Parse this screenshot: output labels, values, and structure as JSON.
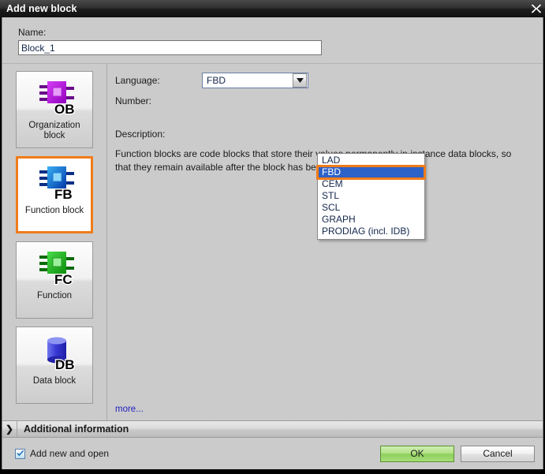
{
  "window": {
    "title": "Add new block",
    "close_icon": "close-icon"
  },
  "name_field": {
    "label": "Name:",
    "value": "Block_1",
    "placeholder": ""
  },
  "sidebar": {
    "items": [
      {
        "label": "Organization\nblock",
        "label_line1": "Organization",
        "label_line2": "block",
        "abbrev": "OB",
        "icon": "organization-block-icon",
        "color": "#b51fd4",
        "selected": false
      },
      {
        "label": "Function block",
        "label_line1": "Function block",
        "label_line2": "",
        "abbrev": "FB",
        "icon": "function-block-icon",
        "color": "#1f7fd4",
        "selected": true
      },
      {
        "label": "Function",
        "label_line1": "Function",
        "label_line2": "",
        "abbrev": "FC",
        "icon": "function-icon",
        "color": "#26a526",
        "selected": false
      },
      {
        "label": "Data block",
        "label_line1": "Data block",
        "label_line2": "",
        "abbrev": "DB",
        "icon": "data-block-icon",
        "color": "#3a3ad4",
        "selected": false
      }
    ]
  },
  "main": {
    "language": {
      "label": "Language:",
      "selected": "FBD",
      "options": [
        "LAD",
        "FBD",
        "CEM",
        "STL",
        "SCL",
        "GRAPH",
        "PRODIAG (incl. IDB)"
      ],
      "highlighted": "FBD",
      "dropdown_open": true,
      "arrow_icon": "chevron-down-icon"
    },
    "number": {
      "label": "Number:",
      "value": ""
    },
    "description": {
      "label": "Description:",
      "text": "Function blocks are code blocks that store their values permanently in instance data blocks, so that they remain available after the block has been executed."
    },
    "more_link": "more..."
  },
  "additional_information": {
    "label": "Additional information",
    "chevron": "❯",
    "expanded": false
  },
  "footer": {
    "checkbox": {
      "label": "Add new and open",
      "checked": true
    },
    "ok_label": "OK",
    "cancel_label": "Cancel"
  },
  "colors": {
    "selection_orange": "#f07c1a",
    "highlight_blue": "#2d62c8",
    "ok_green": "#8ed05d",
    "link_blue": "#2020c0"
  }
}
